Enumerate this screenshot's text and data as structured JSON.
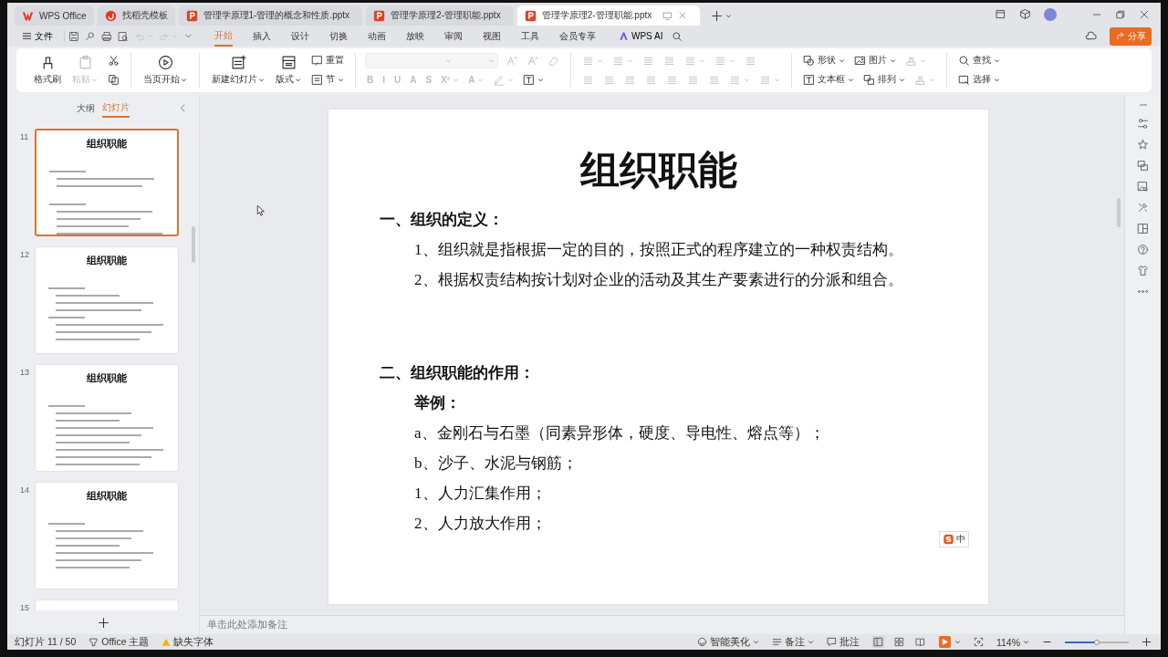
{
  "tabs": [
    {
      "label": "WPS Office",
      "kind": "home",
      "selected": false
    },
    {
      "label": "找稻壳模板",
      "kind": "template",
      "selected": false
    },
    {
      "label": "管理学原理1-管理的概念和性质.pptx",
      "kind": "document",
      "selected": false
    },
    {
      "label": "管理学原理2-管理职能.pptx",
      "kind": "document",
      "selected": false
    },
    {
      "label": "管理学原理2-管理职能.pptx",
      "kind": "document",
      "selected": true
    }
  ],
  "menu": {
    "file": "文件",
    "tabs": [
      {
        "label": "开始",
        "selected": true
      },
      {
        "label": "插入",
        "selected": false
      },
      {
        "label": "设计",
        "selected": false
      },
      {
        "label": "切换",
        "selected": false
      },
      {
        "label": "动画",
        "selected": false
      },
      {
        "label": "放映",
        "selected": false
      },
      {
        "label": "审阅",
        "selected": false
      },
      {
        "label": "视图",
        "selected": false
      },
      {
        "label": "工具",
        "selected": false
      },
      {
        "label": "会员专享",
        "selected": false
      }
    ],
    "ai": "WPS AI",
    "share": "分享"
  },
  "ribbon": {
    "groups": [
      {
        "large": [
          {
            "label": "格式刷",
            "disabled": false,
            "dropdown": false
          },
          {
            "label": "粘贴",
            "disabled": true,
            "dropdown": true
          }
        ],
        "rows": [
          [
            {
              "kind": "tool",
              "disabled": false,
              "dropdown": false
            }
          ],
          [
            {
              "kind": "tool",
              "disabled": false,
              "dropdown": false
            }
          ]
        ]
      },
      {
        "large": [
          {
            "label": "当页开始",
            "disabled": false,
            "dropdown": true
          }
        ]
      },
      {
        "large": [
          {
            "label": "新建幻灯片",
            "disabled": false,
            "dropdown": true
          },
          {
            "label": "版式",
            "disabled": false,
            "dropdown": true
          }
        ],
        "rows": [
          [
            {
              "kind": "small",
              "label": "重置",
              "disabled": false,
              "dropdown": false
            }
          ],
          [
            {
              "kind": "small",
              "label": "节",
              "disabled": false,
              "dropdown": true
            }
          ]
        ]
      },
      {
        "rows": [
          [
            {
              "kind": "field",
              "disabled": true,
              "dropdown": true
            },
            {
              "kind": "tool",
              "disabled": true,
              "dropdown": false
            },
            {
              "kind": "tool",
              "disabled": true,
              "dropdown": false
            },
            {
              "kind": "tool",
              "disabled": true,
              "dropdown": false
            }
          ],
          [
            {
              "kind": "glyph",
              "label": "B",
              "disabled": true,
              "dropdown": false
            },
            {
              "kind": "glyph",
              "label": "I",
              "disabled": true,
              "dropdown": false
            },
            {
              "kind": "glyph",
              "label": "U",
              "disabled": true,
              "dropdown": false
            },
            {
              "kind": "glyph",
              "label": "A",
              "disabled": true,
              "dropdown": false
            },
            {
              "kind": "glyph",
              "label": "S",
              "disabled": true,
              "dropdown": false
            },
            {
              "kind": "glyph",
              "label": "X²",
              "disabled": true,
              "dropdown": true
            },
            {
              "kind": "glyph",
              "label": "A",
              "disabled": true,
              "dropdown": true
            },
            {
              "kind": "tool",
              "disabled": true,
              "dropdown": true
            },
            {
              "kind": "tool",
              "disabled": false,
              "dropdown": true
            }
          ]
        ]
      },
      {
        "rows": [
          [
            {
              "kind": "tool",
              "disabled": true,
              "dropdown": true
            },
            {
              "kind": "tool",
              "disabled": true,
              "dropdown": true
            },
            {
              "kind": "tool",
              "disabled": true,
              "dropdown": false
            },
            {
              "kind": "tool",
              "disabled": true,
              "dropdown": false
            },
            {
              "kind": "tool",
              "disabled": true,
              "dropdown": true
            },
            {
              "kind": "tool",
              "disabled": true,
              "dropdown": true
            },
            {
              "kind": "tool",
              "disabled": true,
              "dropdown": false
            }
          ],
          [
            {
              "kind": "tool",
              "disabled": true,
              "dropdown": false
            },
            {
              "kind": "tool",
              "disabled": true,
              "dropdown": false
            },
            {
              "kind": "tool",
              "disabled": true,
              "dropdown": false
            },
            {
              "kind": "tool",
              "disabled": true,
              "dropdown": false
            },
            {
              "kind": "tool",
              "disabled": true,
              "dropdown": false
            },
            {
              "kind": "tool",
              "disabled": true,
              "dropdown": false
            },
            {
              "kind": "tool",
              "disabled": true,
              "dropdown": false
            },
            {
              "kind": "tool",
              "disabled": true,
              "dropdown": true
            },
            {
              "kind": "tool",
              "disabled": true,
              "dropdown": true
            }
          ]
        ]
      },
      {
        "rows": [
          [
            {
              "kind": "small",
              "label": "形状",
              "disabled": false,
              "dropdown": true
            },
            {
              "kind": "small",
              "label": "图片",
              "disabled": false,
              "dropdown": true
            },
            {
              "kind": "tool",
              "disabled": true,
              "dropdown": true
            }
          ],
          [
            {
              "kind": "small",
              "label": "文本框",
              "disabled": false,
              "dropdown": true
            },
            {
              "kind": "small",
              "label": "排列",
              "disabled": false,
              "dropdown": true
            },
            {
              "kind": "tool",
              "disabled": true,
              "dropdown": true
            }
          ]
        ]
      },
      {
        "rows": [
          [
            {
              "kind": "small",
              "label": "查找",
              "disabled": false,
              "dropdown": true
            }
          ],
          [
            {
              "kind": "small",
              "label": "选择",
              "disabled": false,
              "dropdown": true
            }
          ]
        ]
      }
    ]
  },
  "panel": {
    "tabs": [
      {
        "label": "大纲",
        "selected": false
      },
      {
        "label": "幻灯片",
        "selected": true
      }
    ],
    "slides": [
      {
        "number": "11",
        "title": "组织职能",
        "selected": true
      },
      {
        "number": "12",
        "title": "组织职能",
        "selected": false
      },
      {
        "number": "13",
        "title": "组织职能",
        "selected": false
      },
      {
        "number": "14",
        "title": "组织职能",
        "selected": false
      },
      {
        "number": "15",
        "selected": false
      }
    ]
  },
  "slide": {
    "title": "组织职能",
    "lines": [
      {
        "kind": "section",
        "text": "一、组织的定义："
      },
      {
        "kind": "item",
        "text": "1、组织就是指根据一定的目的，按照正式的程序建立的一种权责结构。"
      },
      {
        "kind": "item",
        "text": "2、根据权责结构按计划对企业的活动及其生产要素进行的分派和组合。"
      },
      {
        "kind": "section",
        "text": "二、组织职能的作用："
      },
      {
        "kind": "label",
        "text": "举例："
      },
      {
        "kind": "item",
        "text": "a、金刚石与石墨（同素异形体，硬度、导电性、熔点等）；"
      },
      {
        "kind": "item",
        "text": "b、沙子、水泥与钢筋；"
      },
      {
        "kind": "item",
        "text": "1、人力汇集作用；"
      },
      {
        "kind": "item",
        "text": "2、人力放大作用；"
      }
    ]
  },
  "ime": {
    "label": "中"
  },
  "notes": {
    "placeholder": "单击此处添加备注"
  },
  "status": {
    "slide": "幻灯片 11 / 50",
    "theme": "Office 主题",
    "missing_fonts": "缺失字体",
    "beautify": "智能美化",
    "notes": "备注",
    "comments": "批注",
    "views": [
      {
        "kind": "normal",
        "selected": true
      },
      {
        "kind": "sorter",
        "selected": false
      },
      {
        "kind": "reading",
        "selected": false
      }
    ],
    "zoom": "114%",
    "zoom_slider": {
      "level": 0.5
    }
  }
}
